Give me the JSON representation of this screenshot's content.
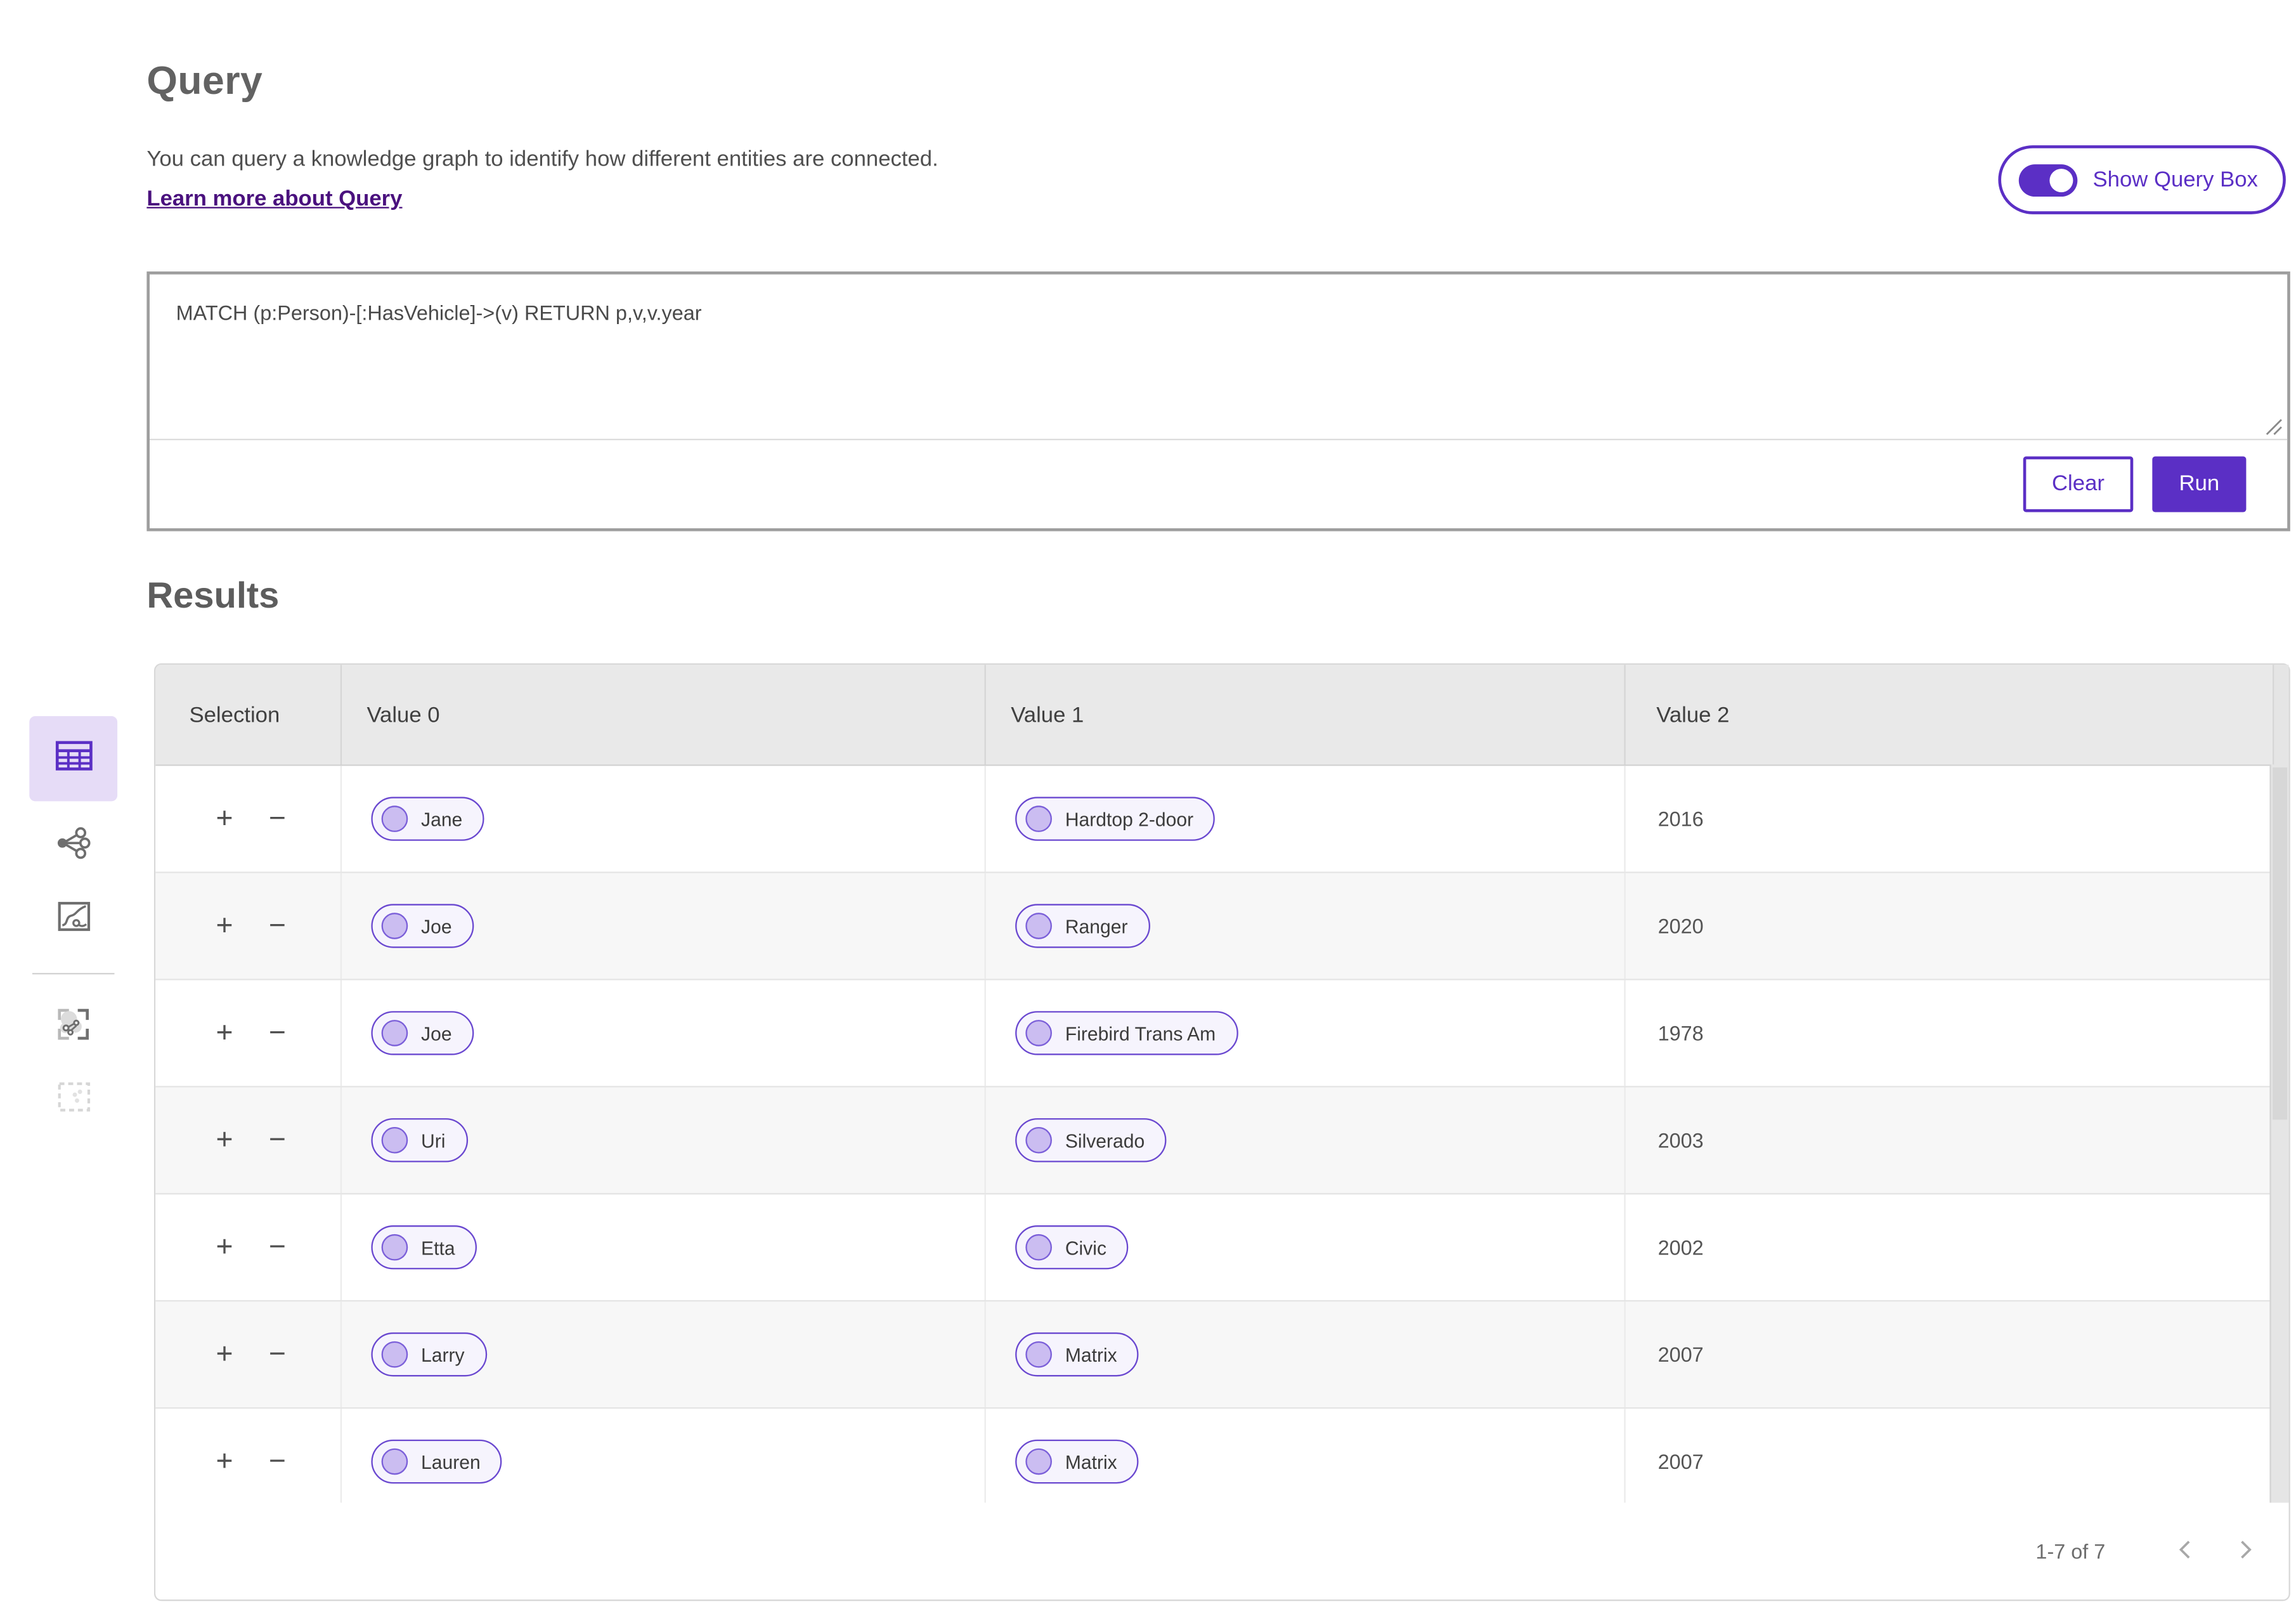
{
  "header": {
    "title": "Query",
    "description": "You can query a knowledge graph to identify how different entities are connected.",
    "learn_more": "Learn more about Query",
    "toggle_label": "Show Query Box",
    "toggle_state": "on"
  },
  "query_box": {
    "text": "MATCH (p:Person)-[:HasVehicle]->(v) RETURN p,v,v.year",
    "clear_label": "Clear",
    "run_label": "Run"
  },
  "sidebar": {
    "items": [
      {
        "icon": "table-view-icon",
        "active": true
      },
      {
        "icon": "graph-network-icon",
        "active": false
      },
      {
        "icon": "map-route-icon",
        "active": false
      },
      {
        "icon": "graph-frame-icon",
        "active": false
      },
      {
        "icon": "selection-box-icon",
        "active": false,
        "disabled": true
      }
    ]
  },
  "results": {
    "title": "Results",
    "columns": [
      "Selection",
      "Value 0",
      "Value 1",
      "Value 2"
    ],
    "add_label": "+",
    "remove_label": "−",
    "rows": [
      {
        "value0": "Jane",
        "value1": "Hardtop 2-door",
        "value2": "2016"
      },
      {
        "value0": "Joe",
        "value1": "Ranger",
        "value2": "2020"
      },
      {
        "value0": "Joe",
        "value1": "Firebird Trans Am",
        "value2": "1978"
      },
      {
        "value0": "Uri",
        "value1": "Silverado",
        "value2": "2003"
      },
      {
        "value0": "Etta",
        "value1": "Civic",
        "value2": "2002"
      },
      {
        "value0": "Larry",
        "value1": "Matrix",
        "value2": "2007"
      },
      {
        "value0": "Lauren",
        "value1": "Matrix",
        "value2": "2007"
      }
    ],
    "pagination": {
      "range": "1-7 of 7",
      "prev_icon": "chevron-left-icon",
      "next_icon": "chevron-right-icon"
    }
  },
  "colors": {
    "accent_purple": "#5b2fc5",
    "pill_border": "#6a48d0",
    "pill_bg": "#f6f4fd",
    "pill_dot": "#cbbdf1",
    "link_purple": "#4a117e",
    "header_gray": "#e9e9e9",
    "row_alt_gray": "#f7f7f7"
  }
}
